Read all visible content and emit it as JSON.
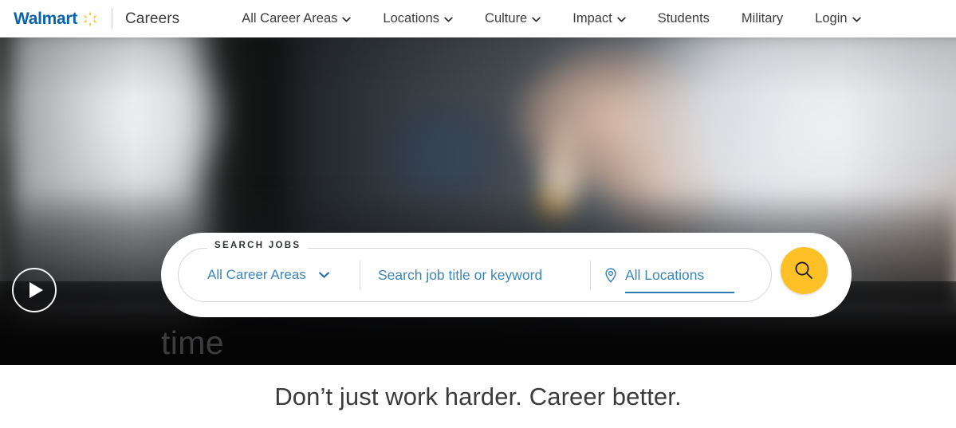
{
  "header": {
    "logo": {
      "wordmark": "Walmart",
      "spark_icon": "walmart-spark-icon",
      "spark_color": "#ffc220",
      "word_color": "#0a63b0"
    },
    "site_name": "Careers",
    "nav": [
      {
        "label": "All Career Areas",
        "has_dropdown": true
      },
      {
        "label": "Locations",
        "has_dropdown": true
      },
      {
        "label": "Culture",
        "has_dropdown": true
      },
      {
        "label": "Impact",
        "has_dropdown": true
      },
      {
        "label": "Students",
        "has_dropdown": false
      },
      {
        "label": "Military",
        "has_dropdown": false
      },
      {
        "label": "Login",
        "has_dropdown": true
      }
    ]
  },
  "hero": {
    "play_button_icon": "play-icon",
    "caption_partial": "time",
    "image_description": "Blurred pharmacy scene: pharmacist in white coat holding an amber prescription pill bottle"
  },
  "search": {
    "legend": "SEARCH JOBS",
    "career_area_value": "All Career Areas",
    "career_area_chevron_icon": "chevron-down-icon",
    "keyword_placeholder": "Search job title or keyword",
    "keyword_value": "",
    "location_pin_icon": "location-pin-icon",
    "location_value": "All Locations",
    "location_placeholder": "All Locations",
    "submit_icon": "search-icon",
    "submit_color": "#fdc127",
    "text_color": "#3c85bd"
  },
  "tagline": {
    "text": "Don’t just work harder. Career better."
  }
}
